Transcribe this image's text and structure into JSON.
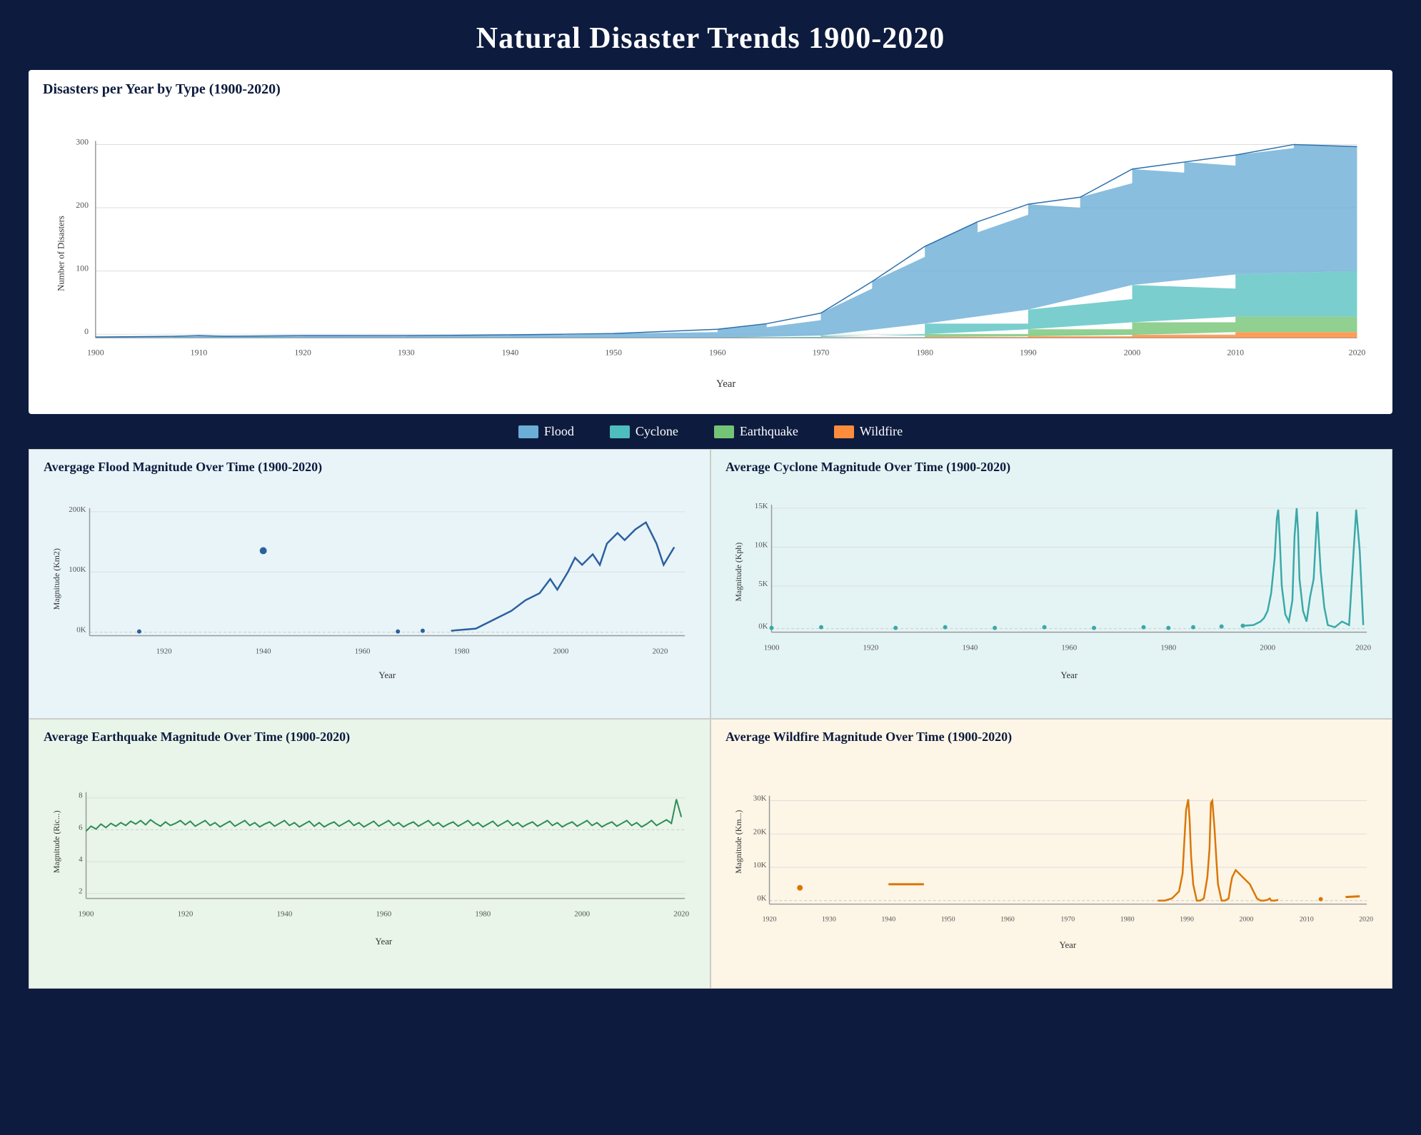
{
  "title": "Natural Disaster Trends 1900-2020",
  "top_chart": {
    "subtitle": "Disasters per Year by Type (1900-2020)",
    "y_label": "Number of Disasters",
    "x_label": "Year",
    "y_ticks": [
      "300",
      "200",
      "100",
      "0"
    ],
    "x_ticks": [
      "1900",
      "1910",
      "1920",
      "1930",
      "1940",
      "1950",
      "1960",
      "1970",
      "1980",
      "1990",
      "2000",
      "2010",
      "2020"
    ]
  },
  "legend": [
    {
      "label": "Flood",
      "color": "#6baed6"
    },
    {
      "label": "Cyclone",
      "color": "#4dbdbd"
    },
    {
      "label": "Earthquake",
      "color": "#74c476"
    },
    {
      "label": "Wildfire",
      "color": "#fd8d3c"
    }
  ],
  "bottom_charts": [
    {
      "title": "Avergage Flood Magnitude Over Time (1900-2020)",
      "y_label": "Magnitude (Km2)",
      "x_label": "Year",
      "y_ticks": [
        "200K",
        "100K",
        "0K"
      ],
      "x_ticks": [
        "1920",
        "1940",
        "1960",
        "1980",
        "2000",
        "2020"
      ],
      "type": "flood"
    },
    {
      "title": "Average Cyclone Magnitude Over Time (1900-2020)",
      "y_label": "Magnitude (Kph)",
      "x_label": "Year",
      "y_ticks": [
        "15K",
        "10K",
        "5K",
        "0K"
      ],
      "x_ticks": [
        "1900",
        "1920",
        "1940",
        "1960",
        "1980",
        "2000",
        "2020"
      ],
      "type": "cyclone"
    },
    {
      "title": "Average Earthquake Magnitude Over Time (1900-2020)",
      "y_label": "Magnitude (Ric...)",
      "x_label": "Year",
      "y_ticks": [
        "8",
        "6",
        "4",
        "2"
      ],
      "x_ticks": [
        "1900",
        "1920",
        "1940",
        "1960",
        "1980",
        "2000",
        "2020"
      ],
      "type": "earthquake"
    },
    {
      "title": "Average Wildfire Magnitude Over Time (1900-2020)",
      "y_label": "Magnitude (Km...)",
      "x_label": "Year",
      "y_ticks": [
        "30K",
        "20K",
        "10K",
        "0K"
      ],
      "x_ticks": [
        "1920",
        "1930",
        "1940",
        "1950",
        "1960",
        "1970",
        "1980",
        "1990",
        "2000",
        "2010",
        "2020"
      ],
      "type": "wildfire"
    }
  ]
}
